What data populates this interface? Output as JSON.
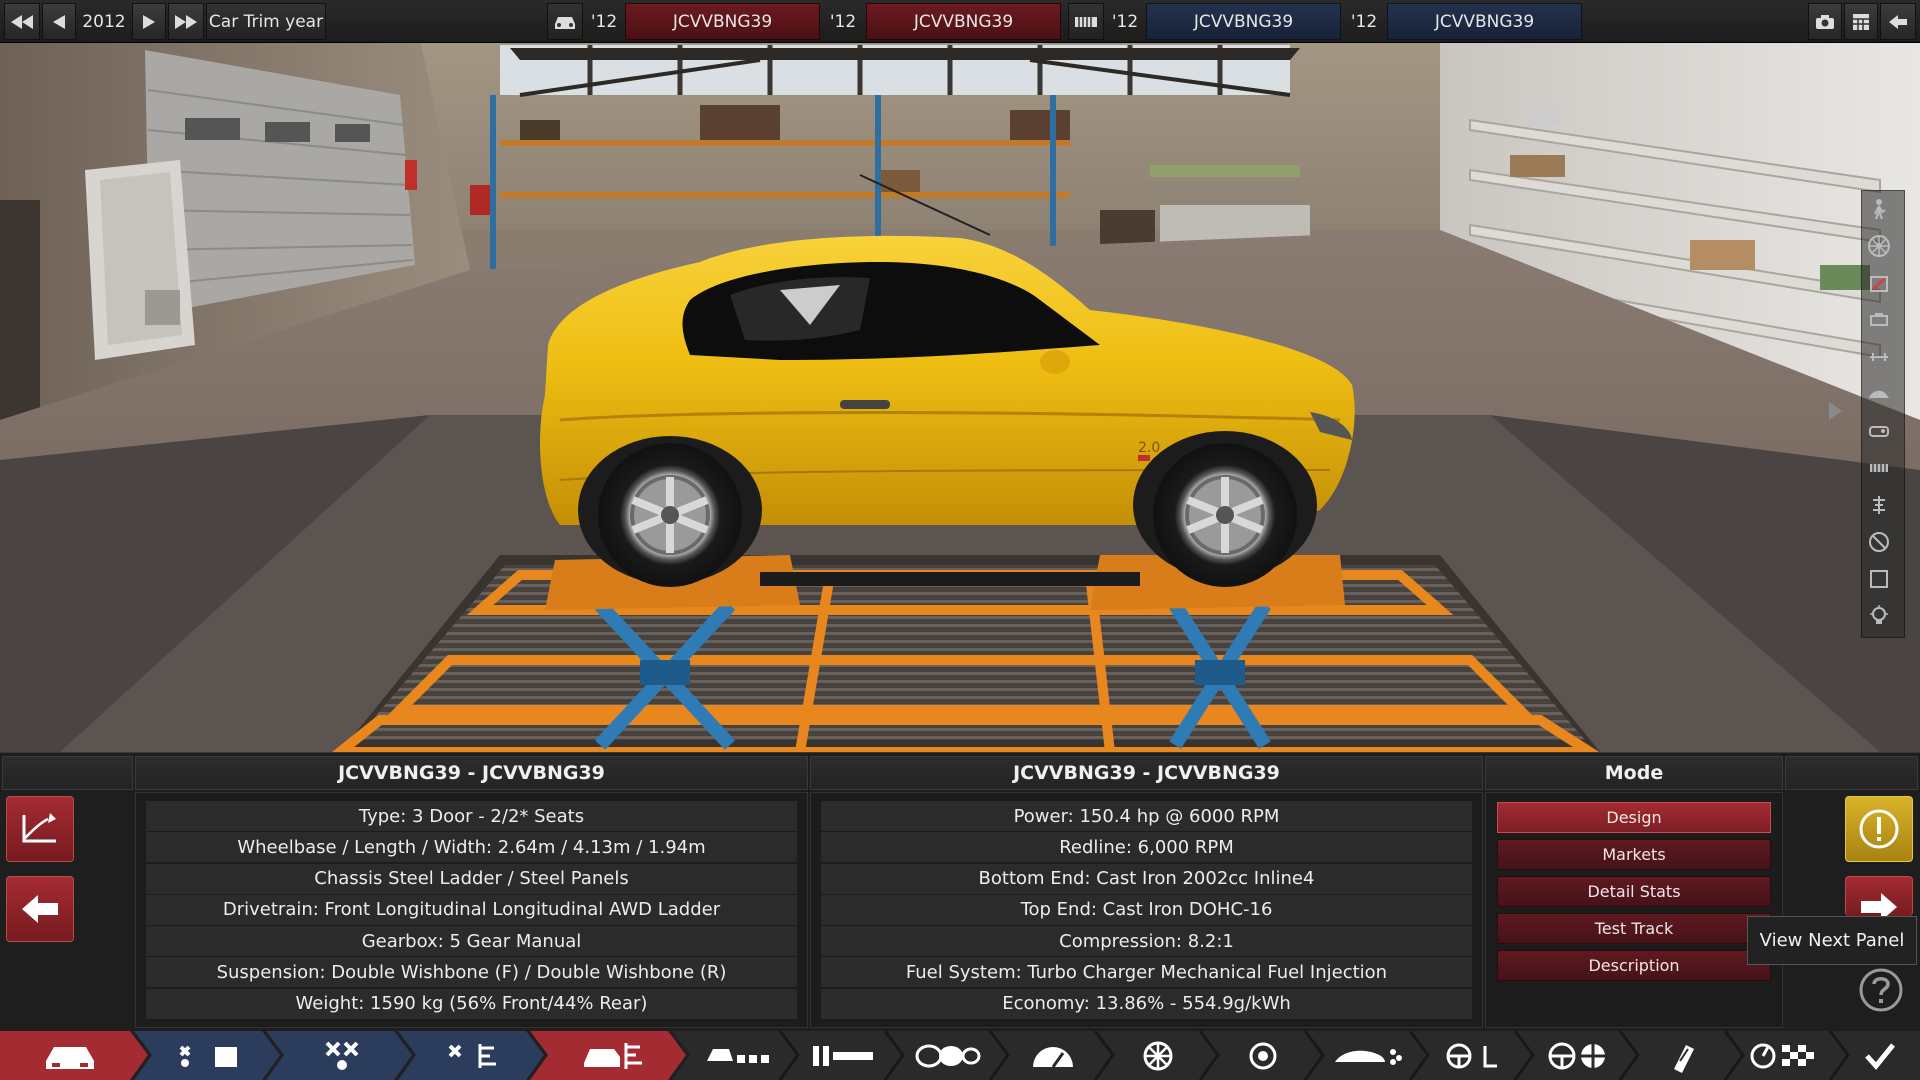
{
  "topbar": {
    "year_value": "2012",
    "trim_label": "Car Trim year",
    "model_a_year": "'12",
    "model_a_name": "JCVVBNG39",
    "trim_a_year": "'12",
    "trim_a_name": "JCVVBNG39",
    "engine_year": "'12",
    "engine_name": "JCVVBNG39",
    "engine_variant_year": "'12",
    "engine_variant_name": "JCVVBNG39"
  },
  "scene": {
    "badge": "2.0"
  },
  "panel": {
    "car_heading": "JCVVBNG39 - JCVVBNG39",
    "engine_heading": "JCVVBNG39 - JCVVBNG39",
    "mode_heading": "Mode",
    "car_stats": [
      "Type: 3 Door - 2/2* Seats",
      "Wheelbase / Length / Width: 2.64m / 4.13m / 1.94m",
      "Chassis Steel Ladder / Steel Panels",
      "Drivetrain: Front Longitudinal Longitudinal AWD Ladder",
      "Gearbox: 5 Gear Manual",
      "Suspension: Double Wishbone (F) / Double Wishbone (R)",
      "Weight: 1590 kg (56% Front/44% Rear)"
    ],
    "engine_stats": [
      "Power: 150.4 hp @ 6000 RPM",
      "Redline:  6,000 RPM",
      "Bottom End: Cast Iron 2002cc Inline4",
      "Top End: Cast Iron DOHC-16",
      "Compression: 8.2:1",
      "Fuel System: Turbo Charger Mechanical Fuel Injection",
      "Economy: 13.86% - 554.9g/kWh"
    ],
    "modes": [
      "Design",
      "Markets",
      "Detail Stats",
      "Test Track",
      "Description"
    ],
    "active_mode": "Design",
    "tooltip": "View Next Panel"
  },
  "colors": {
    "accent_red": "#a42b32",
    "accent_blue": "#23324d",
    "warning_yellow": "#c9a21a",
    "car_yellow": "#f1c21a"
  }
}
